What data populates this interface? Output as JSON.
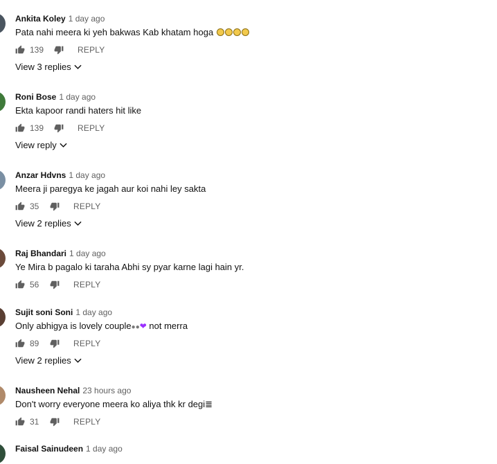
{
  "comments": [
    {
      "author": "Ankita Koley",
      "time": "1 day ago",
      "text": "Pata nahi meera ki yeh bakwas Kab khatam hoga",
      "likes": "139",
      "reply_label": "REPLY",
      "replies_label": "View 3 replies",
      "avatar_color": "#4a5560"
    },
    {
      "author": "Roni Bose",
      "time": "1 day ago",
      "text": "Ekta kapoor randi haters hit like",
      "likes": "139",
      "reply_label": "REPLY",
      "replies_label": "View reply",
      "avatar_color": "#3f7a3a"
    },
    {
      "author": "Anzar Hdvns",
      "time": "1 day ago",
      "text": "Meera ji paregya ke jagah aur koi nahi ley sakta",
      "likes": "35",
      "reply_label": "REPLY",
      "replies_label": "View 2 replies",
      "avatar_color": "#7a8fa3"
    },
    {
      "author": "Raj Bhandari",
      "time": "1 day ago",
      "text": "Ye Mira b pagalo ki taraha Abhi sy pyar karne lagi hain yr.",
      "likes": "56",
      "reply_label": "REPLY",
      "replies_label": "",
      "avatar_color": "#6b4a3a"
    },
    {
      "author": "Sujit soni Soni",
      "time": "1 day ago",
      "text_before": "Only abhigya is lovely couple",
      "text_glyph": "❤",
      "text_after": " not merra",
      "likes": "89",
      "reply_label": "REPLY",
      "replies_label": "View 2 replies",
      "avatar_color": "#5a3f33"
    },
    {
      "author": "Nausheen Nehal",
      "time": "23 hours ago",
      "text": "Don't worry everyone meera ko aliya thk kr degi",
      "text_tail": "≣",
      "likes": "31",
      "reply_label": "REPLY",
      "replies_label": "",
      "avatar_color": "#b08a6a"
    },
    {
      "author": "Faisal Sainudeen",
      "time": "1 day ago",
      "avatar_color": "#2f4f3a"
    }
  ],
  "icons": {
    "like": "thumb-up-icon",
    "dislike": "thumb-down-icon",
    "expand": "chevron-down-icon"
  }
}
